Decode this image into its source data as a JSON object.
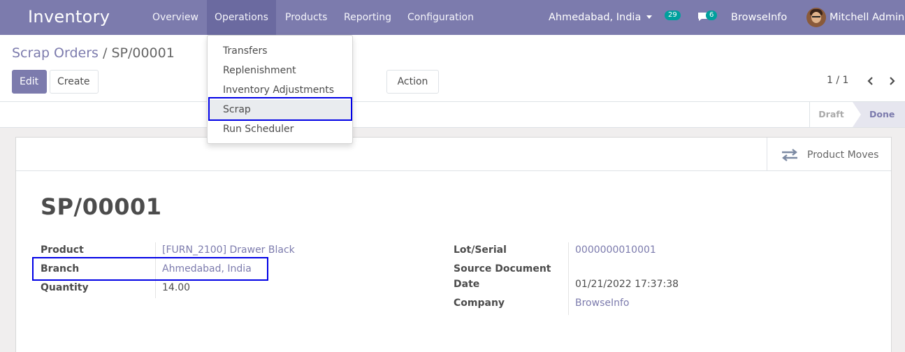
{
  "navbar": {
    "app_name": "Inventory",
    "menu": [
      "Overview",
      "Operations",
      "Products",
      "Reporting",
      "Configuration"
    ],
    "branch": "Ahmedabad, India",
    "activity_count": "29",
    "message_count": "6",
    "company": "BrowseInfo",
    "user": "Mitchell Admin"
  },
  "breadcrumb": {
    "parent": "Scrap Orders",
    "separator": " / ",
    "current": "SP/00001"
  },
  "actions": {
    "edit": "Edit",
    "create": "Create",
    "action": "Action"
  },
  "pager": {
    "text": "1 / 1"
  },
  "status": {
    "draft": "Draft",
    "done": "Done"
  },
  "smart_button": {
    "label": "Product Moves"
  },
  "record": {
    "name": "SP/00001",
    "left": [
      {
        "label": "Product",
        "value": "[FURN_2100] Drawer Black"
      },
      {
        "label": "Branch",
        "value": "Ahmedabad, India"
      },
      {
        "label": "Quantity",
        "value": "14.00"
      }
    ],
    "right": [
      {
        "label": "Lot/Serial",
        "value": "0000000010001"
      },
      {
        "label": "Source Document",
        "value": ""
      },
      {
        "label": "Date",
        "value": "01/21/2022 17:37:38"
      },
      {
        "label": "Company",
        "value": "BrowseInfo"
      }
    ]
  },
  "operations_menu": [
    "Transfers",
    "Replenishment",
    "Inventory Adjustments",
    "Scrap",
    "Run Scheduler"
  ],
  "colors": {
    "brand": "#7c7bad",
    "highlight": "#0000e6",
    "badge": "#00a09d"
  }
}
